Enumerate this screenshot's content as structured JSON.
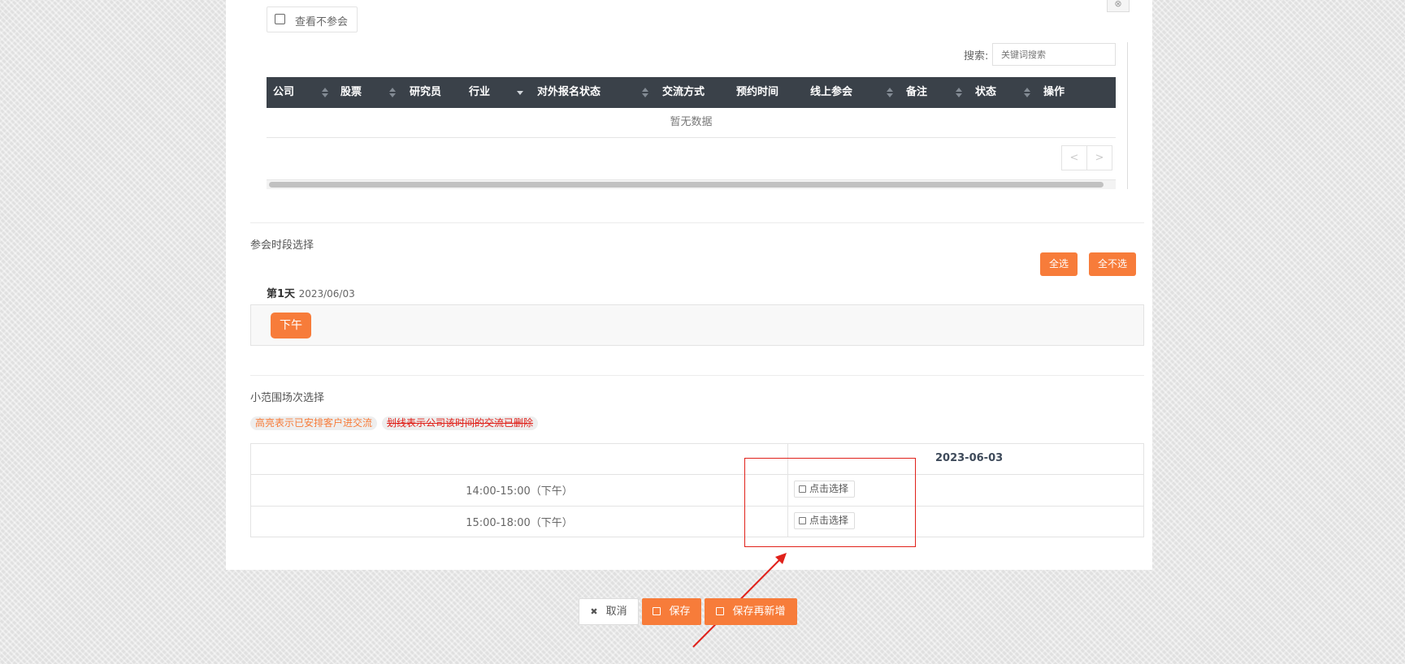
{
  "filter": {
    "checkbox_label": "查看不参会",
    "close_icon": "⊗"
  },
  "search": {
    "label": "搜索:",
    "placeholder": "关键词搜索"
  },
  "table": {
    "columns": [
      "公司",
      "股票",
      "研究员",
      "行业",
      "对外报名状态",
      "交流方式",
      "预约时间",
      "线上参会",
      "备注",
      "状态",
      "操作"
    ],
    "empty_text": "暂无数据",
    "pager_prev": "<",
    "pager_next": ">"
  },
  "session_select": {
    "title": "参会时段选择",
    "select_all": "全选",
    "select_none": "全不选",
    "day_label": "第1天",
    "day_date": "2023/06/03",
    "slot_button": "下午"
  },
  "small_session": {
    "title": "小范围场次选择",
    "legend_highlight": "高亮表示已安排客户进交流",
    "legend_strike": "划线表示公司该时间的交流已删除",
    "date_header": "2023-06-03",
    "rows": [
      {
        "time": "14:00-15:00（下午）",
        "action": "点击选择"
      },
      {
        "time": "15:00-18:00（下午）",
        "action": "点击选择"
      }
    ]
  },
  "footer": {
    "cancel": "取消",
    "save": "保存",
    "save_new": "保存再新增",
    "cancel_icon": "✖"
  },
  "colors": {
    "accent": "#f77c3a",
    "header_bg": "#3a4149",
    "annotation_red": "#e0211a"
  }
}
